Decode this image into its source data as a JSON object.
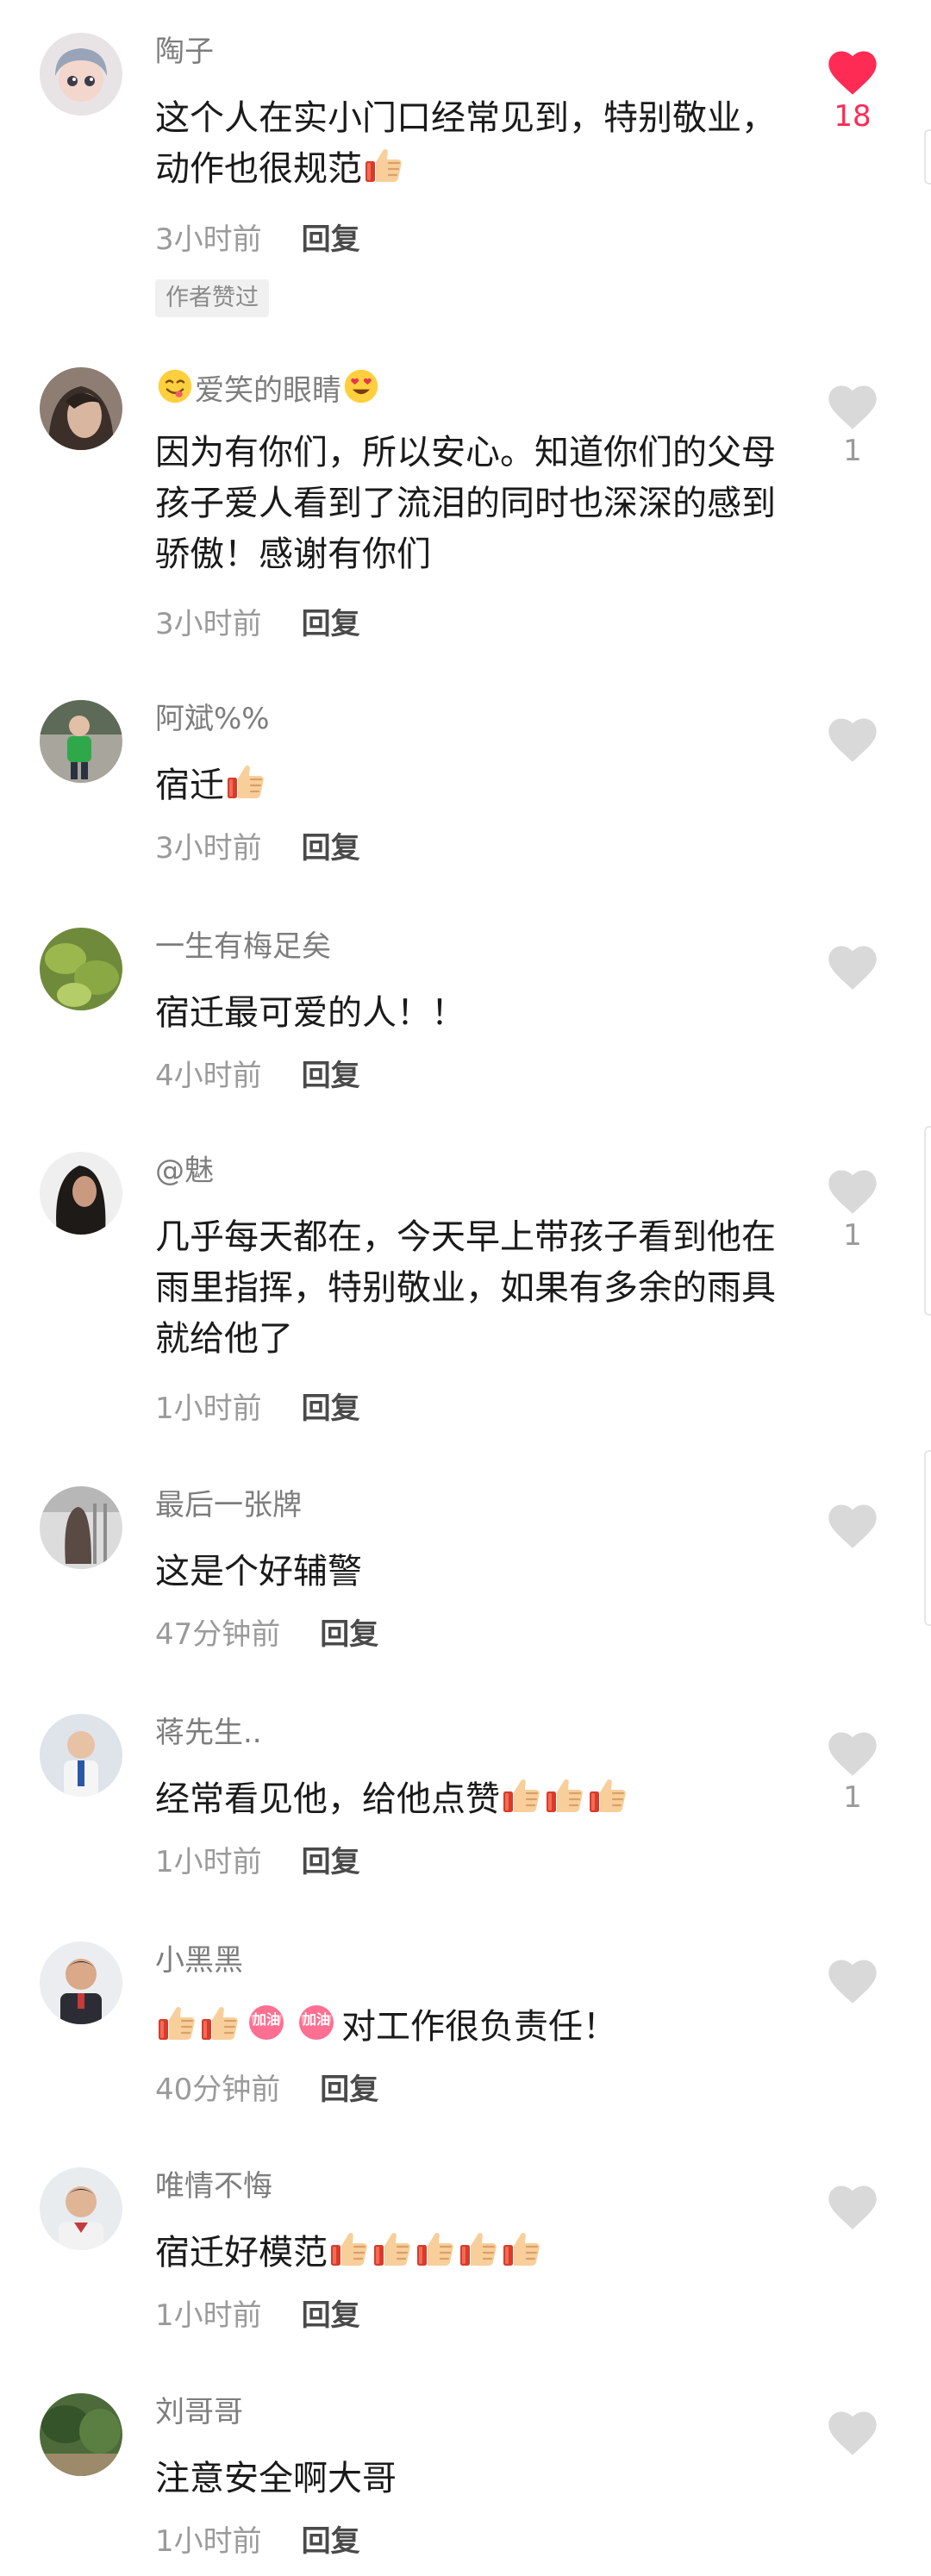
{
  "colors": {
    "liked": "#fe2c55",
    "heart_unliked": "#d9d9d9",
    "username": "#7d7d7d",
    "meta": "#9a9a9a",
    "reply": "#4a4a4a"
  },
  "comments": [
    {
      "username": "陶子",
      "text_parts": [
        "这个人在实小门口经常见到，特别敬业，动作也很规范"
      ],
      "time": "3小时前",
      "reply_label": "回复",
      "badge": "作者赞过",
      "likes": "18",
      "liked": true,
      "emojis": [
        "thumbs-up-icon"
      ]
    },
    {
      "username_parts": [
        "爱笑的眼睛"
      ],
      "username_emojis": [
        "yum-face-icon",
        "heart-eyes-icon"
      ],
      "text": "因为有你们，所以安心。知道你们的父母孩子爱人看到了流泪的同时也深深的感到骄傲！感谢有你们",
      "time": "3小时前",
      "reply_label": "回复",
      "likes": "1"
    },
    {
      "username": "阿斌%%",
      "text": "宿迁",
      "emojis": [
        "thumbs-up-icon"
      ],
      "time": "3小时前",
      "reply_label": "回复"
    },
    {
      "username": "一生有梅足矣",
      "text": "宿迁最可爱的人！！",
      "time": "4小时前",
      "reply_label": "回复"
    },
    {
      "username": "@魅",
      "text": "几乎每天都在，今天早上带孩子看到他在雨里指挥，特别敬业，如果有多余的雨具就给他了",
      "time": "1小时前",
      "reply_label": "回复",
      "likes": "1"
    },
    {
      "username": "最后一张牌",
      "text": "这是个好辅警",
      "time": "47分钟前",
      "reply_label": "回复"
    },
    {
      "username": "蒋先生..",
      "text": "经常看见他，给他点赞",
      "emojis": [
        "thumbs-up-icon",
        "thumbs-up-icon",
        "thumbs-up-icon"
      ],
      "time": "1小时前",
      "reply_label": "回复",
      "likes": "1"
    },
    {
      "username": "小黑黑",
      "text": "对工作很负责任！",
      "prefix_emojis": [
        "thumbs-up-icon",
        "thumbs-up-icon",
        "jiayou-icon",
        "jiayou-icon"
      ],
      "jiayou_label": "加油",
      "time": "40分钟前",
      "reply_label": "回复"
    },
    {
      "username": "唯情不悔",
      "text": "宿迁好模范",
      "emojis": [
        "thumbs-up-icon",
        "thumbs-up-icon",
        "thumbs-up-icon",
        "thumbs-up-icon",
        "thumbs-up-icon"
      ],
      "time": "1小时前",
      "reply_label": "回复"
    },
    {
      "username": "刘哥哥",
      "text": "注意安全啊大哥",
      "time": "1小时前",
      "reply_label": "回复"
    }
  ]
}
